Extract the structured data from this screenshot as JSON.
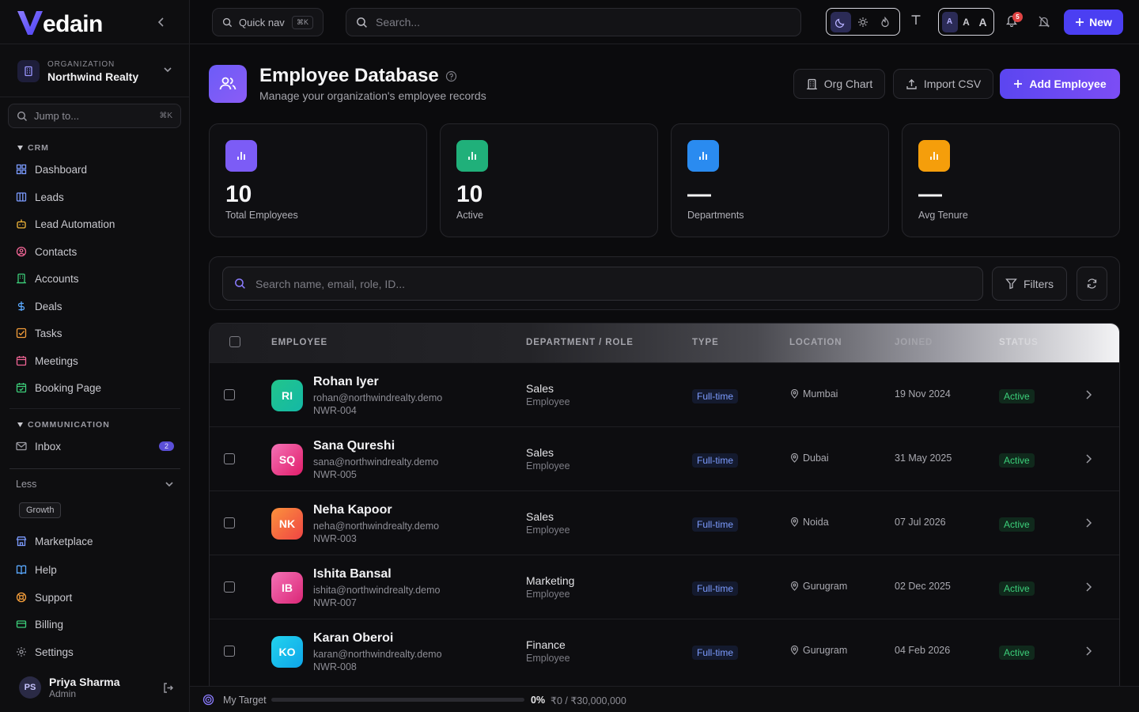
{
  "brand": {
    "name": "edain",
    "logo_letter": "V"
  },
  "organization": {
    "label": "ORGANIZATION",
    "name": "Northwind Realty"
  },
  "jump": {
    "placeholder": "Jump to...",
    "shortcut": "⌘K"
  },
  "sidebar": {
    "crm_title": "CRM",
    "crm_items": [
      {
        "label": "Dashboard",
        "icon": "grid-icon",
        "color": "#7c9cff"
      },
      {
        "label": "Leads",
        "icon": "columns-icon",
        "color": "#7c9cff"
      },
      {
        "label": "Lead Automation",
        "icon": "robot-icon",
        "color": "#f5b93a"
      },
      {
        "label": "Contacts",
        "icon": "contact-icon",
        "color": "#f06595"
      },
      {
        "label": "Accounts",
        "icon": "building-icon",
        "color": "#3ccf7a"
      },
      {
        "label": "Deals",
        "icon": "dollar-icon",
        "color": "#5aa9ff"
      },
      {
        "label": "Tasks",
        "icon": "checkbox-icon",
        "color": "#f59e3a"
      },
      {
        "label": "Meetings",
        "icon": "calendar-icon",
        "color": "#f06595"
      },
      {
        "label": "Booking Page",
        "icon": "calendar-check-icon",
        "color": "#3ccf7a"
      }
    ],
    "comm_title": "COMMUNICATION",
    "comm_items": [
      {
        "label": "Inbox",
        "icon": "mail-icon",
        "color": "#9a9aa2",
        "badge": "2"
      }
    ],
    "less_label": "Less",
    "growth_tag": "Growth",
    "bottom_items": [
      {
        "label": "Marketplace",
        "icon": "store-icon",
        "color": "#7c9cff"
      },
      {
        "label": "Help",
        "icon": "book-icon",
        "color": "#5aa9ff"
      },
      {
        "label": "Support",
        "icon": "lifebuoy-icon",
        "color": "#f59e3a"
      },
      {
        "label": "Billing",
        "icon": "card-icon",
        "color": "#3ccf7a"
      },
      {
        "label": "Settings",
        "icon": "gear-icon",
        "color": "#9a9aa2"
      }
    ]
  },
  "user": {
    "initials": "PS",
    "name": "Priya Sharma",
    "role": "Admin"
  },
  "topbar": {
    "quicknav_label": "Quick nav",
    "quicknav_shortcut": "⌘K",
    "search_placeholder": "Search...",
    "size_small": "A",
    "size_medium": "A",
    "size_large": "A",
    "notification_count": "5",
    "new_label": "New"
  },
  "page": {
    "title": "Employee Database",
    "subtitle": "Manage your organization's employee records",
    "org_chart_label": "Org Chart",
    "import_label": "Import CSV",
    "add_label": "Add Employee"
  },
  "stats": [
    {
      "value": "10",
      "label": "Total Employees",
      "color": "#7c5cf6"
    },
    {
      "value": "10",
      "label": "Active",
      "color": "#20b07a"
    },
    {
      "value": "—",
      "label": "Departments",
      "color": "#2a8bf0"
    },
    {
      "value": "—",
      "label": "Avg Tenure",
      "color": "#f59e0b"
    }
  ],
  "filters": {
    "search_placeholder": "Search name, email, role, ID...",
    "filters_label": "Filters"
  },
  "table": {
    "headers": [
      "EMPLOYEE",
      "DEPARTMENT / ROLE",
      "TYPE",
      "LOCATION",
      "JOINED",
      "STATUS"
    ],
    "rows": [
      {
        "initials": "RI",
        "name": "Rohan Iyer",
        "email": "rohan@northwindrealty.demo",
        "id": "NWR-004",
        "dept": "Sales",
        "role": "Employee",
        "type": "Full-time",
        "location": "Mumbai",
        "joined": "19 Nov 2024",
        "status": "Active",
        "color_from": "#22c58b",
        "color_to": "#14b8a6"
      },
      {
        "initials": "SQ",
        "name": "Sana Qureshi",
        "email": "sana@northwindrealty.demo",
        "id": "NWR-005",
        "dept": "Sales",
        "role": "Employee",
        "type": "Full-time",
        "location": "Dubai",
        "joined": "31 May 2025",
        "status": "Active",
        "color_from": "#f472b6",
        "color_to": "#e11d6a"
      },
      {
        "initials": "NK",
        "name": "Neha Kapoor",
        "email": "neha@northwindrealty.demo",
        "id": "NWR-003",
        "dept": "Sales",
        "role": "Employee",
        "type": "Full-time",
        "location": "Noida",
        "joined": "07 Jul 2026",
        "status": "Active",
        "color_from": "#fb923c",
        "color_to": "#ef4444"
      },
      {
        "initials": "IB",
        "name": "Ishita Bansal",
        "email": "ishita@northwindrealty.demo",
        "id": "NWR-007",
        "dept": "Marketing",
        "role": "Employee",
        "type": "Full-time",
        "location": "Gurugram",
        "joined": "02 Dec 2025",
        "status": "Active",
        "color_from": "#f472b6",
        "color_to": "#db2777"
      },
      {
        "initials": "KO",
        "name": "Karan Oberoi",
        "email": "karan@northwindrealty.demo",
        "id": "NWR-008",
        "dept": "Finance",
        "role": "Employee",
        "type": "Full-time",
        "location": "Gurugram",
        "joined": "04 Feb 2026",
        "status": "Active",
        "color_from": "#22d3ee",
        "color_to": "#0ea5e9"
      }
    ]
  },
  "target": {
    "label": "My Target",
    "percent": "0%",
    "progress": 0,
    "amount": "₹0 / ₹30,000,000"
  }
}
